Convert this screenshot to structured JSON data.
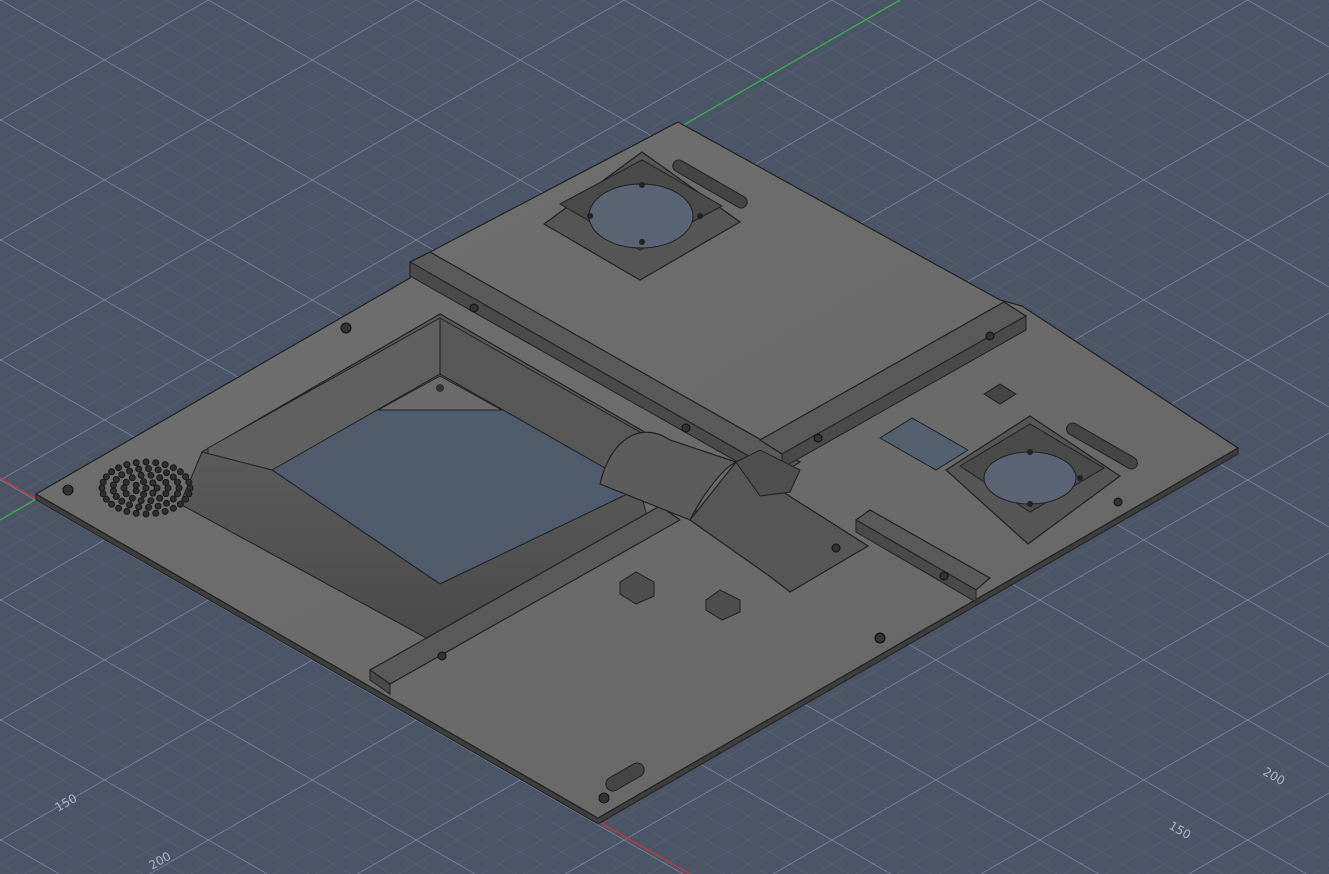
{
  "viewport": {
    "background": "#4b5566",
    "grid_minor_color": "#5b6577",
    "grid_major_color": "#8893a6",
    "axis_x_color": "#c23b3b",
    "axis_y_color": "#3fae4f",
    "model_color": "#6c6c6c",
    "grid_labels": {
      "left_150": "150",
      "left_200": "200",
      "right_150": "150",
      "right_200": "200"
    }
  }
}
